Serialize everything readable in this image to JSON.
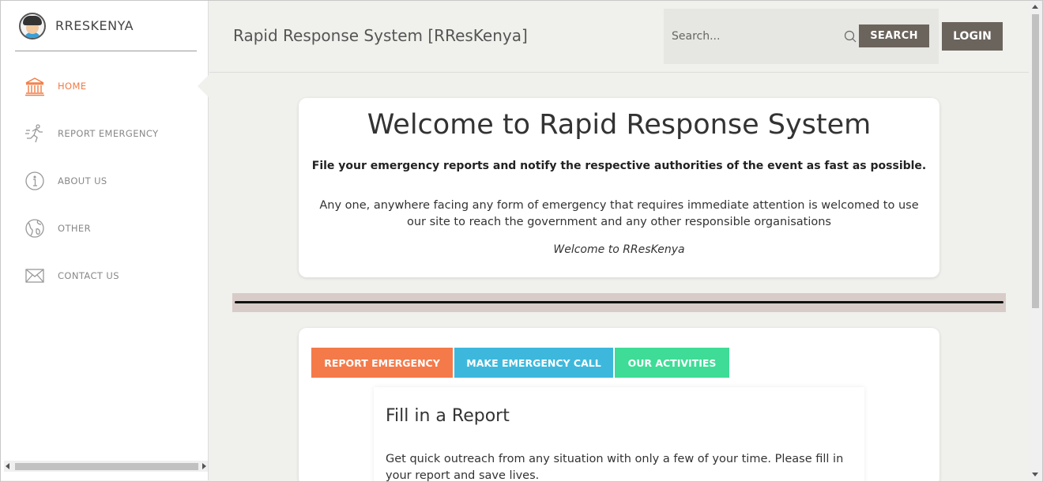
{
  "brand": {
    "name": "RRESKENYA"
  },
  "sidebar": {
    "items": [
      {
        "label": "HOME",
        "icon": "bank-icon",
        "active": true
      },
      {
        "label": "REPORT EMERGENCY",
        "icon": "running-person-icon",
        "active": false
      },
      {
        "label": "ABOUT US",
        "icon": "info-icon",
        "active": false
      },
      {
        "label": "OTHER",
        "icon": "globe-icon",
        "active": false
      },
      {
        "label": "CONTACT US",
        "icon": "envelope-icon",
        "active": false
      }
    ]
  },
  "header": {
    "title": "Rapid Response System [RResKenya]",
    "search_placeholder": "Search...",
    "search_label": "SEARCH",
    "login_label": "LOGIN"
  },
  "welcome": {
    "title": "Welcome to Rapid Response System",
    "subtitle": "File your emergency reports and notify the respective authorities of the event as fast as possible.",
    "body": "Any one, anywhere facing any form of emergency that requires immediate attention is welcomed to use our site to reach the government and any other responsible organisations",
    "footer": "Welcome to RResKenya"
  },
  "tabs": [
    {
      "label": "REPORT EMERGENCY",
      "color": "#f47a4a"
    },
    {
      "label": "MAKE EMERGENCY CALL",
      "color": "#3db8dc"
    },
    {
      "label": "OUR ACTIVITIES",
      "color": "#3edc96"
    }
  ],
  "report": {
    "title": "Fill in a Report",
    "body": "Get quick outreach from any situation with only a few of your time. Please fill in your report and save lives."
  },
  "colors": {
    "accent": "#f07a42",
    "button": "#6b645c"
  }
}
